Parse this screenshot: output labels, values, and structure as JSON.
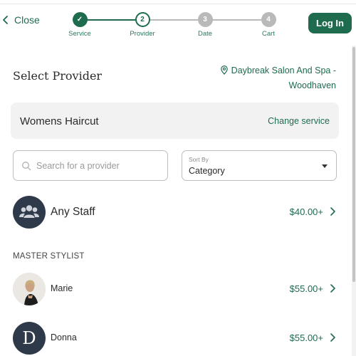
{
  "header": {
    "close_label": "Close",
    "login_label": "Log In"
  },
  "steps": [
    {
      "label": "Service",
      "marker": "✓",
      "state": "done"
    },
    {
      "label": "Provider",
      "marker": "2",
      "state": "current"
    },
    {
      "label": "Date",
      "marker": "3",
      "state": "todo"
    },
    {
      "label": "Cart",
      "marker": "4",
      "state": "todo"
    }
  ],
  "page": {
    "title": "Select Provider",
    "location_line1": "Daybreak Salon And Spa -",
    "location_line2": "Woodhaven"
  },
  "service": {
    "name": "Womens Haircut",
    "change_label": "Change service"
  },
  "search": {
    "placeholder": "Search for a provider",
    "value": ""
  },
  "sort": {
    "caption": "Sort By",
    "value": "Category"
  },
  "any_staff": {
    "name": "Any Staff",
    "price": "$40.00+"
  },
  "section": {
    "heading": "MASTER STYLIST"
  },
  "providers": [
    {
      "name": "Marie",
      "price": "$55.00+"
    },
    {
      "name": "Donna",
      "price": "$55.00+",
      "initial": "D"
    }
  ],
  "colors": {
    "brand": "#1f6b4e",
    "card_bg": "#f2f2f2",
    "avatar_dark": "#2e3a4a",
    "step_todo": "#b9b9b9"
  }
}
